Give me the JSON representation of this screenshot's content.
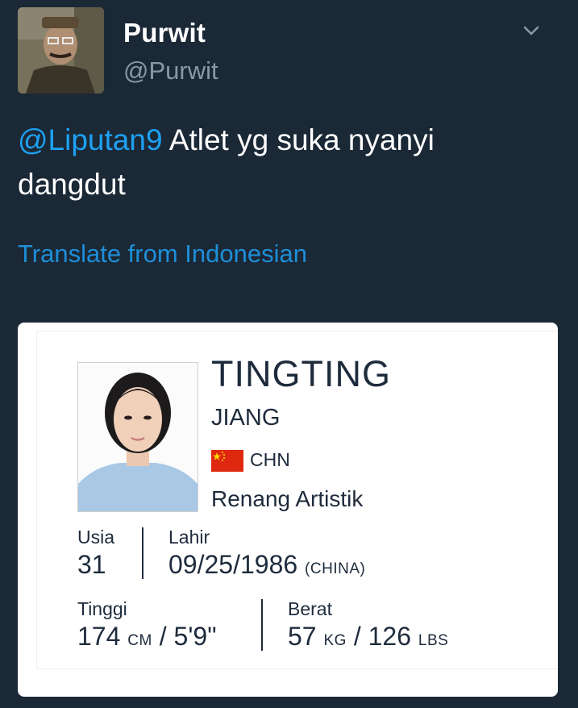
{
  "tweet": {
    "display_name": "Purwit",
    "handle": "@Purwit",
    "mention": "@Liputan9",
    "text": " Atlet yg suka nyanyi dangdut",
    "translate_label": "Translate from Indonesian"
  },
  "icons": {
    "menu": "chevron-down-icon",
    "avatar": "avatar",
    "flag": "china-flag-icon"
  },
  "colors": {
    "background": "#1b2836",
    "link": "#1da1f2",
    "handle": "#8899a6",
    "card_text": "#1e2b3c"
  },
  "athlete_card": {
    "first_name": "TINGTING",
    "last_name": "JIANG",
    "country_code": "CHN",
    "sport": "Renang Artistik",
    "age_label": "Usia",
    "age_value": "31",
    "birth_label": "Lahir",
    "birth_date": "09/25/1986",
    "birth_place": "(CHINA)",
    "height_label": "Tinggi",
    "height_cm": "174",
    "height_cm_unit": "CM",
    "height_sep": "/",
    "height_ft": "5'9\"",
    "weight_label": "Berat",
    "weight_kg": "57",
    "weight_kg_unit": "KG",
    "weight_sep": "/",
    "weight_lbs": "126",
    "weight_lbs_unit": "LBS"
  }
}
